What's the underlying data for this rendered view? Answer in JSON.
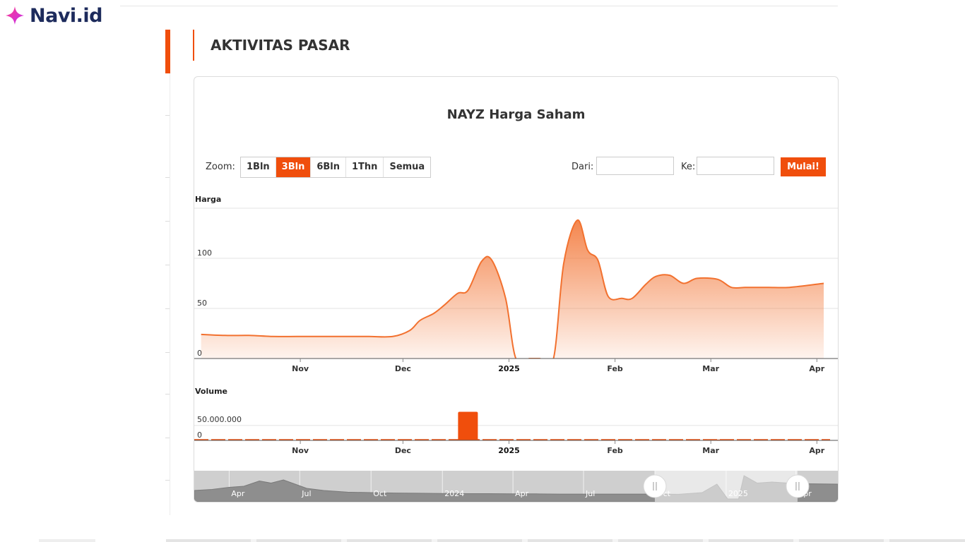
{
  "logo": {
    "text": "Navi.id"
  },
  "section": {
    "title": "AKTIVITAS PASAR"
  },
  "chart_ui": {
    "zoom_label": "Zoom:",
    "zoom_buttons": [
      "1Bln",
      "3Bln",
      "6Bln",
      "1Thn",
      "Semua"
    ],
    "zoom_active": "3Bln",
    "from_label": "Dari:",
    "to_label": "Ke:",
    "from_value": "",
    "to_value": "",
    "go_label": "Mulai!"
  },
  "colors": {
    "accent": "#f04e0c",
    "line": "#f2712f",
    "text": "#333333",
    "navigator": "#8e8e8e"
  },
  "chart_data": {
    "type": "area",
    "title": "NAYZ Harga Saham",
    "price_panel": {
      "ylabel": "Harga",
      "yticks": [
        0,
        50,
        100
      ],
      "ylim": [
        0,
        150
      ],
      "x": [
        "2024-10-03",
        "2024-10-10",
        "2024-10-17",
        "2024-10-24",
        "2024-10-31",
        "2024-11-07",
        "2024-11-14",
        "2024-11-21",
        "2024-11-28",
        "2024-12-03",
        "2024-12-06",
        "2024-12-10",
        "2024-12-13",
        "2024-12-17",
        "2024-12-20",
        "2024-12-24",
        "2024-12-27",
        "2024-12-31",
        "2025-01-03",
        "2025-01-07",
        "2025-01-10",
        "2025-01-14",
        "2025-01-17",
        "2025-01-21",
        "2025-01-24",
        "2025-01-27",
        "2025-01-30",
        "2025-02-03",
        "2025-02-06",
        "2025-02-10",
        "2025-02-13",
        "2025-02-17",
        "2025-02-21",
        "2025-02-25",
        "2025-03-03",
        "2025-03-07",
        "2025-03-11",
        "2025-03-14",
        "2025-03-18",
        "2025-03-24",
        "2025-04-03"
      ],
      "values": [
        24,
        23,
        23,
        22,
        22,
        22,
        22,
        22,
        22,
        28,
        38,
        45,
        53,
        65,
        68,
        97,
        98,
        60,
        0,
        0,
        0,
        0,
        95,
        138,
        108,
        98,
        62,
        60,
        60,
        74,
        82,
        83,
        75,
        80,
        79,
        71,
        71,
        71,
        71,
        71,
        75
      ]
    },
    "volume_panel": {
      "ylabel": "Volume",
      "ytick_labels": [
        "0",
        "50.000.000"
      ],
      "ylim": [
        0,
        80000000
      ],
      "bars": [
        {
          "x": "2024-12-20",
          "value": 72000000
        },
        {
          "x": "2025-03-03",
          "value": 2000000
        }
      ]
    },
    "x_ticks": [
      {
        "date": "2024-11-01",
        "label": "Nov",
        "bold": false
      },
      {
        "date": "2024-12-01",
        "label": "Dec",
        "bold": false
      },
      {
        "date": "2025-01-01",
        "label": "2025",
        "bold": true
      },
      {
        "date": "2025-02-01",
        "label": "Feb",
        "bold": false
      },
      {
        "date": "2025-03-01",
        "label": "Mar",
        "bold": false
      },
      {
        "date": "2025-04-01",
        "label": "Apr",
        "bold": false
      }
    ],
    "xlim": [
      "2024-10-01",
      "2025-04-03"
    ],
    "navigator": {
      "xlim": [
        "2023-02-15",
        "2025-05-25"
      ],
      "labels": [
        {
          "date": "2023-04-01",
          "label": "Apr"
        },
        {
          "date": "2023-07-01",
          "label": "Jul"
        },
        {
          "date": "2023-10-01",
          "label": "Oct"
        },
        {
          "date": "2024-01-01",
          "label": "2024"
        },
        {
          "date": "2024-04-01",
          "label": "Apr"
        },
        {
          "date": "2024-07-01",
          "label": "Jul"
        },
        {
          "date": "2024-10-01",
          "label": "Oct"
        },
        {
          "date": "2025-01-01",
          "label": "2025"
        },
        {
          "date": "2025-04-01",
          "label": "Apr"
        }
      ],
      "selection": [
        "2024-10-01",
        "2025-04-03"
      ],
      "x": [
        "2023-02-15",
        "2023-03-10",
        "2023-04-01",
        "2023-04-20",
        "2023-05-10",
        "2023-05-25",
        "2023-06-10",
        "2023-06-25",
        "2023-07-10",
        "2023-08-01",
        "2023-09-01",
        "2023-10-01",
        "2023-11-01",
        "2023-12-01",
        "2024-01-01",
        "2024-02-01",
        "2024-03-01",
        "2024-04-01",
        "2024-05-01",
        "2024-06-01",
        "2024-07-01",
        "2024-08-01",
        "2024-09-01",
        "2024-10-01",
        "2024-11-01",
        "2024-12-01",
        "2024-12-20",
        "2025-01-03",
        "2025-01-17",
        "2025-01-24",
        "2025-02-10",
        "2025-03-01",
        "2025-04-03",
        "2025-05-25"
      ],
      "values": [
        40,
        45,
        55,
        60,
        85,
        75,
        90,
        70,
        50,
        40,
        32,
        30,
        28,
        27,
        26,
        25,
        25,
        24,
        24,
        23,
        23,
        23,
        23,
        23,
        22,
        30,
        70,
        0,
        0,
        110,
        75,
        80,
        72,
        70
      ]
    }
  }
}
